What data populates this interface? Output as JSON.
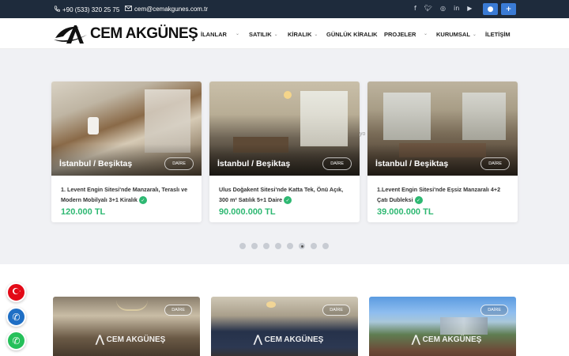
{
  "topbar": {
    "phone": "+90 (533) 320 25 75",
    "email": "cem@cemakgunes.com.tr",
    "social": [
      "facebook-icon",
      "twitter-icon",
      "instagram-icon",
      "linkedin-icon",
      "youtube-icon"
    ]
  },
  "header": {
    "logo_text": "CEM AKGÜNEŞ",
    "nav": [
      {
        "label": "İLANLAR",
        "chevron": false
      },
      {
        "label": "",
        "chevron": true
      },
      {
        "label": "SATILIK",
        "chevron": true
      },
      {
        "label": "KİRALIK",
        "chevron": true
      },
      {
        "label": "GÜNLÜK KİRALIK",
        "chevron": false
      },
      {
        "label": "PROJELER",
        "chevron": false
      },
      {
        "label": "",
        "chevron": true
      },
      {
        "label": "KURUMSAL",
        "chevron": true
      },
      {
        "label": "İLETİŞİM",
        "chevron": false
      }
    ]
  },
  "slider": {
    "cards": [
      {
        "location": "İstanbul / Beşiktaş",
        "badge": "DAİRE",
        "title": "1. Levent Engin Sitesi'nde Manzaralı, Teraslı ve Modern Mobilyalı 3+1 Kiralık",
        "price": "120.000 TL"
      },
      {
        "location": "İstanbul / Beşiktaş",
        "badge": "DAİRE",
        "title": "Ulus Doğakent Sitesi'nde Katta Tek, Önü Açık, 300 m² Satılık 5+1 Daire",
        "price": "90.000.000 TL"
      },
      {
        "location": "İstanbul / Beşiktaş",
        "badge": "DAİRE",
        "title": "1.Levent Engin Sitesi'nde Eşsiz Manzaralı 4+2 Çatı Dubleksi",
        "price": "39.000.000 TL"
      }
    ],
    "dot_count": 8,
    "active_dot": 5,
    "ghost_text": "yo"
  },
  "listings": {
    "cards": [
      {
        "badge": "DAİRE",
        "watermark": "CEM AKGÜNEŞ"
      },
      {
        "badge": "DAİRE",
        "watermark": "CEM AKGÜNEŞ"
      },
      {
        "badge": "DAİRE",
        "watermark": "CEM AKGÜNEŞ"
      }
    ]
  },
  "fabs": [
    "turkey-flag-icon",
    "phone-icon",
    "whatsapp-icon"
  ],
  "colors": {
    "topbar": "#1e2b3c",
    "accent": "#3a7bd5",
    "price": "#2eb872",
    "whatsapp": "#25c05a",
    "phone_fab": "#1f6fc5",
    "flag": "#e30a17"
  }
}
